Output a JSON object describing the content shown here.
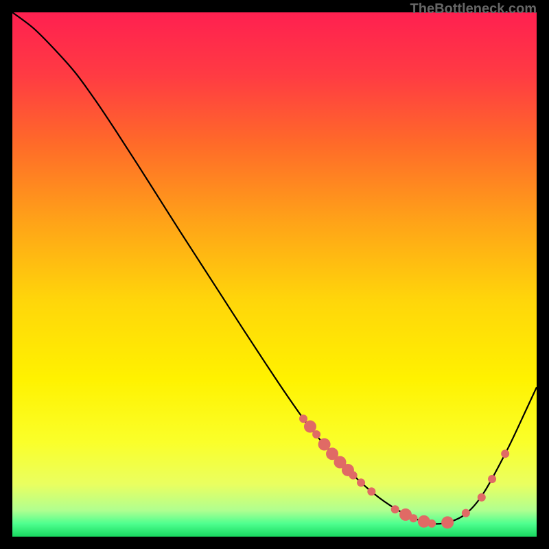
{
  "watermark": "TheBottleneck.com",
  "chart_data": {
    "type": "line",
    "title": "",
    "xlabel": "",
    "ylabel": "",
    "xlim": [
      0,
      100
    ],
    "ylim": [
      0,
      100
    ],
    "background_gradient": {
      "stops": [
        {
          "offset": 0.0,
          "color": "#ff2050"
        },
        {
          "offset": 0.12,
          "color": "#ff3b43"
        },
        {
          "offset": 0.25,
          "color": "#ff6a29"
        },
        {
          "offset": 0.4,
          "color": "#ffa318"
        },
        {
          "offset": 0.55,
          "color": "#ffd60a"
        },
        {
          "offset": 0.7,
          "color": "#fff200"
        },
        {
          "offset": 0.82,
          "color": "#faff2a"
        },
        {
          "offset": 0.9,
          "color": "#eaff60"
        },
        {
          "offset": 0.95,
          "color": "#b0ff90"
        },
        {
          "offset": 0.975,
          "color": "#4fff8f"
        },
        {
          "offset": 1.0,
          "color": "#18d860"
        }
      ]
    },
    "series": [
      {
        "name": "bottleneck-curve",
        "color": "#000000",
        "x": [
          0,
          4,
          8,
          12,
          16,
          20,
          24,
          28,
          32,
          36,
          40,
          44,
          48,
          52,
          56,
          58,
          60,
          63,
          66,
          68,
          70,
          72,
          74,
          76,
          78,
          80,
          82,
          84,
          86,
          88,
          90,
          92,
          95,
          98,
          100
        ],
        "y": [
          100,
          97,
          93,
          88.5,
          83,
          77,
          70.8,
          64.5,
          58.2,
          52,
          45.8,
          39.6,
          33.5,
          27.5,
          21.8,
          19.3,
          17.0,
          13.8,
          10.8,
          9.0,
          7.4,
          6.0,
          4.8,
          3.8,
          3.0,
          2.5,
          2.5,
          3.0,
          4.0,
          5.8,
          8.5,
          12.0,
          17.8,
          24.2,
          28.5
        ]
      }
    ],
    "markers": {
      "name": "highlight-dots",
      "color": "#e06a65",
      "radius_small": 6,
      "radius_large": 9,
      "points": [
        {
          "x": 55.5,
          "y": 22.5,
          "r": "small"
        },
        {
          "x": 56.8,
          "y": 21.0,
          "r": "large"
        },
        {
          "x": 58.0,
          "y": 19.5,
          "r": "small"
        },
        {
          "x": 59.5,
          "y": 17.6,
          "r": "large"
        },
        {
          "x": 61.0,
          "y": 15.8,
          "r": "large"
        },
        {
          "x": 62.5,
          "y": 14.2,
          "r": "large"
        },
        {
          "x": 64.0,
          "y": 12.7,
          "r": "large"
        },
        {
          "x": 65.0,
          "y": 11.7,
          "r": "small"
        },
        {
          "x": 66.5,
          "y": 10.3,
          "r": "small"
        },
        {
          "x": 68.5,
          "y": 8.6,
          "r": "small"
        },
        {
          "x": 73.0,
          "y": 5.2,
          "r": "small"
        },
        {
          "x": 75.0,
          "y": 4.2,
          "r": "large"
        },
        {
          "x": 76.5,
          "y": 3.5,
          "r": "small"
        },
        {
          "x": 78.5,
          "y": 2.9,
          "r": "large"
        },
        {
          "x": 80.0,
          "y": 2.5,
          "r": "small"
        },
        {
          "x": 83.0,
          "y": 2.7,
          "r": "large"
        },
        {
          "x": 86.5,
          "y": 4.5,
          "r": "small"
        },
        {
          "x": 89.5,
          "y": 7.5,
          "r": "small"
        },
        {
          "x": 91.5,
          "y": 11.0,
          "r": "small"
        },
        {
          "x": 94.0,
          "y": 15.8,
          "r": "small"
        }
      ]
    }
  }
}
